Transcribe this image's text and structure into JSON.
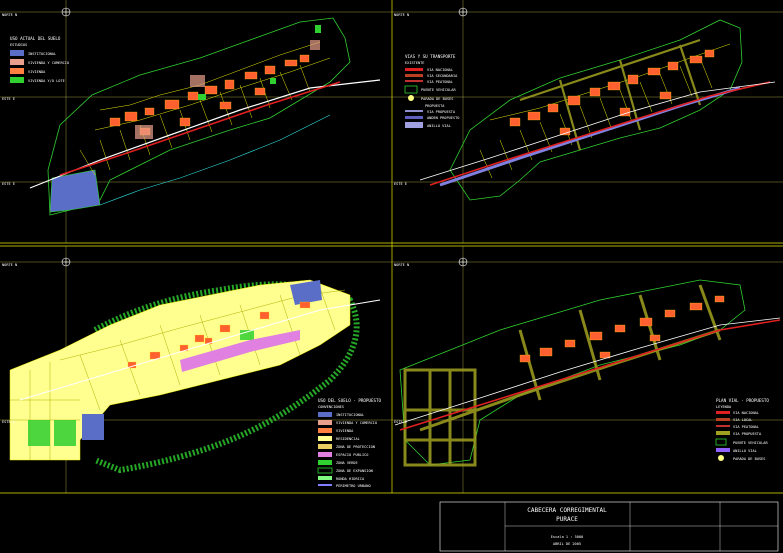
{
  "drawing": {
    "background": "#000000",
    "frame_color": "#e8e800",
    "grid_color": "#e8e800",
    "title_block": {
      "line1": "CABECERA CORREGIMENTAL",
      "line2": "PURACE",
      "scale_label": "Escala 1 : 5000",
      "date_label": "ABRIL DE 2005"
    }
  },
  "panels": [
    {
      "id": "uso-actual",
      "legend_title": "USO ACTUAL DEL SUELO",
      "legend_subtitle": "ESTUDIOS",
      "legend_items": [
        {
          "label": "INSTITUCIONAL",
          "color": "#5a6ec8"
        },
        {
          "label": "VIVIENDA Y COMERCIO",
          "color": "#e8a08c"
        },
        {
          "label": "VIVIENDA",
          "color": "#ff8040"
        },
        {
          "label": "VIVIENDA Y/O LOTE",
          "color": "#30d030"
        }
      ],
      "grid_labels": [
        "NORTE N",
        "ESTE E",
        "ESTE E"
      ]
    },
    {
      "id": "vias",
      "legend_title": "VIAS Y SU TRANSPORTE",
      "legend_subtitle": "EXISTENTE",
      "legend_items": [
        {
          "label": "VIA NACIONAL",
          "color": "#e02020"
        },
        {
          "label": "VIA SECUNDARIA",
          "color": "#b84020"
        },
        {
          "label": "VIA PEATONAL",
          "color": "#c03030"
        },
        {
          "label": "PUENTE VEHICULAR",
          "color": "#30d030"
        },
        {
          "label": "PARADA DE BUSES",
          "color": "#ffff80"
        },
        {
          "label": "PROPUESTA",
          "color": "#ffffff"
        },
        {
          "label": "VIA PROPUESTA",
          "color": "#9090d0"
        },
        {
          "label": "ANDEN PROPUESTO",
          "color": "#6060c0"
        },
        {
          "label": "ANILLO VIAL",
          "color": "#a0a0e0"
        }
      ],
      "grid_labels": [
        "NORTE N",
        "ESTE E"
      ]
    },
    {
      "id": "uso-propuesto",
      "legend_title": "USO DEL SUELO - PROPUESTO",
      "legend_subtitle": "CONVENCIONES",
      "legend_items": [
        {
          "label": "INSTITUCIONAL",
          "color": "#5a6ec8"
        },
        {
          "label": "VIVIENDA Y COMERCIO",
          "color": "#e8a08c"
        },
        {
          "label": "VIVIENDA",
          "color": "#ff8040"
        },
        {
          "label": "RESIDENCIAL",
          "color": "#ffff90"
        },
        {
          "label": "ZONA DE PROTECCION",
          "color": "#e8d060"
        },
        {
          "label": "ESPACIO PUBLICO",
          "color": "#e080e0"
        },
        {
          "label": "ZONA VERDE",
          "color": "#30d030"
        },
        {
          "label": "ZONA DE EXPANSION",
          "color": "#30d030"
        },
        {
          "label": "RONDA HIDRICA",
          "color": "#80ff80"
        },
        {
          "label": "PERIMETRO URBANO",
          "color": "#8080ff"
        }
      ],
      "grid_labels": [
        "NORTE N",
        "ESTE E"
      ]
    },
    {
      "id": "vias-propuesto",
      "legend_title": "PLAN VIAL - PROPUESTO",
      "legend_subtitle": "LEYENDA",
      "legend_items": [
        {
          "label": "VIA NACIONAL",
          "color": "#e02020"
        },
        {
          "label": "VIA LOCAL",
          "color": "#b84020"
        },
        {
          "label": "VIA PEATONAL",
          "color": "#c03030"
        },
        {
          "label": "VIA PROPUESTA",
          "color": "#a0a020"
        },
        {
          "label": "PUENTE VEHICULAR",
          "color": "#30d030"
        },
        {
          "label": "ANILLO VIAL",
          "color": "#9060ff"
        },
        {
          "label": "PARADA DE BUSES",
          "color": "#ffff80"
        }
      ],
      "grid_labels": [
        "NORTE N",
        "ESTE E"
      ]
    }
  ]
}
